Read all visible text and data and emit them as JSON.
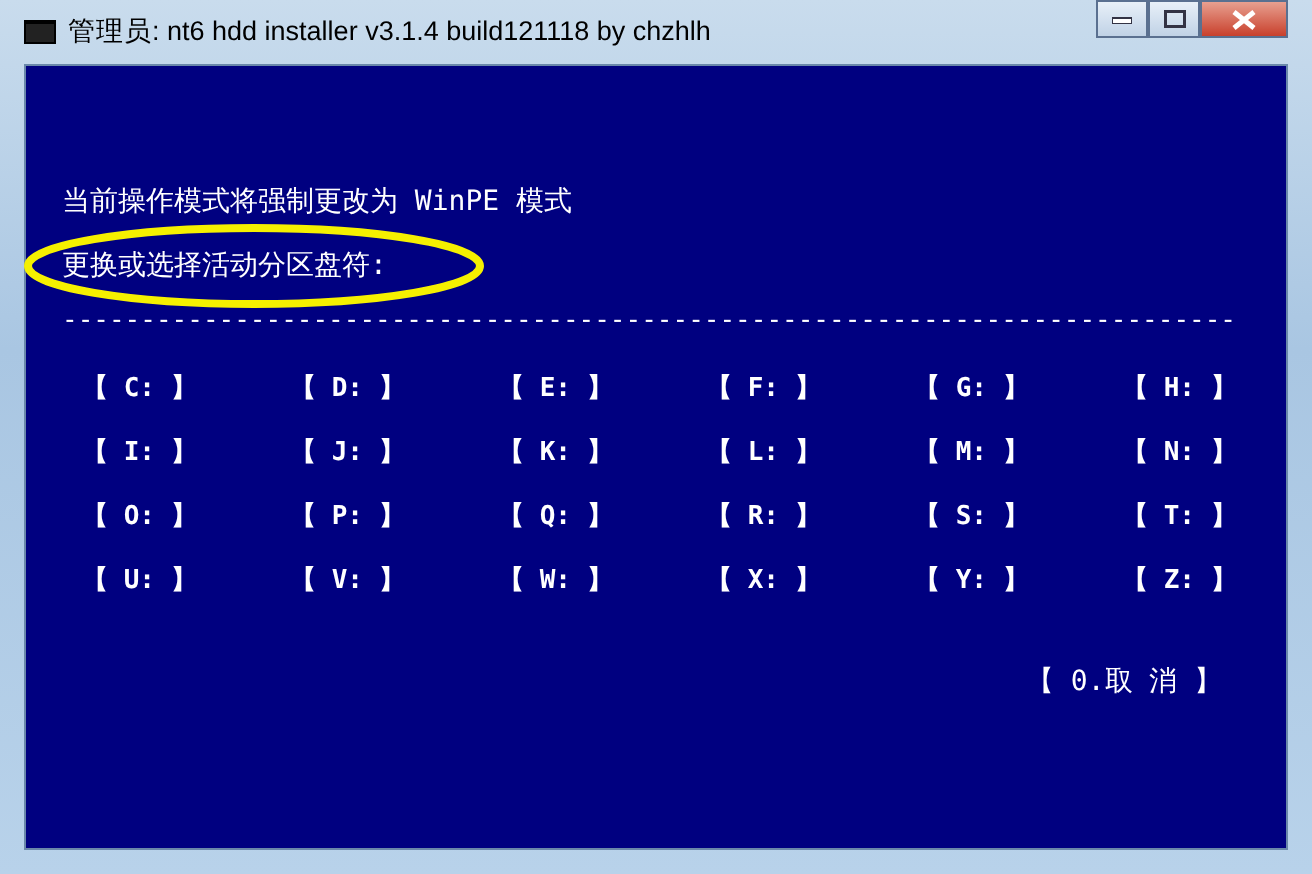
{
  "window": {
    "title": "管理员:  nt6 hdd installer v3.1.4 build121118 by chzhlh"
  },
  "console": {
    "lines": [
      {
        "text": "当前操作模式将强制更改为 WinPE 模式",
        "highlighted": false
      },
      {
        "text": "更换或选择活动分区盘符:",
        "highlighted": true
      }
    ],
    "separator": "---------------------------------------------------------------------------",
    "drive_options": [
      "【 C: 】",
      "【 D: 】",
      "【 E: 】",
      "【 F: 】",
      "【 G: 】",
      "【 H: 】",
      "【 I: 】",
      "【 J: 】",
      "【 K: 】",
      "【 L: 】",
      "【 M: 】",
      "【 N: 】",
      "【 O: 】",
      "【 P: 】",
      "【 Q: 】",
      "【 R: 】",
      "【 S: 】",
      "【 T: 】",
      "【 U: 】",
      "【 V: 】",
      "【 W: 】",
      "【 X: 】",
      "【 Y: 】",
      "【 Z: 】"
    ],
    "cancel_option": "【 0.取  消 】"
  }
}
